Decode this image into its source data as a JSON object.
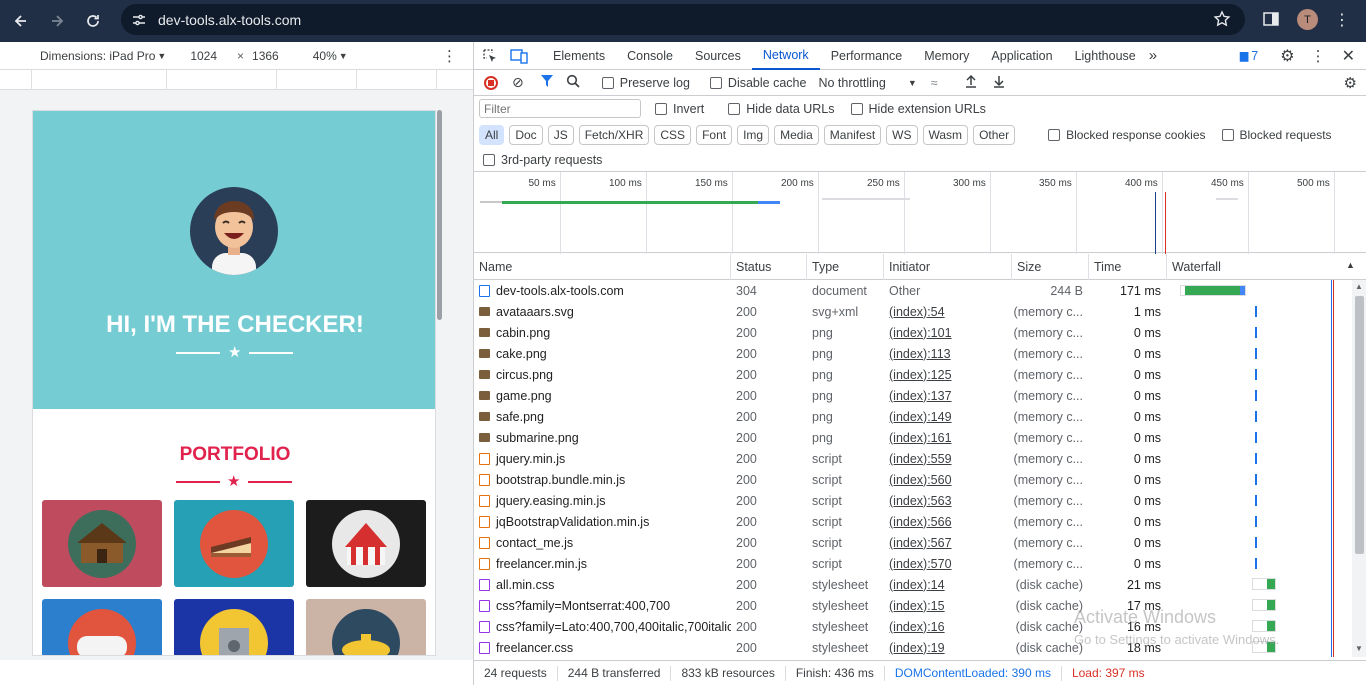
{
  "browser": {
    "url": "dev-tools.alx-tools.com",
    "profile_initial": "T"
  },
  "emulation": {
    "device": "Dimensions: iPad Pro",
    "width": "1024",
    "times": "×",
    "height": "1366",
    "zoom": "40%"
  },
  "page": {
    "hero_title": "HI, I'M THE CHECKER!",
    "portfolio_title": "PORTFOLIO",
    "tiles": [
      {
        "name": "cabin",
        "bg": "#be4b5e"
      },
      {
        "name": "cake",
        "bg": "#25a0b4"
      },
      {
        "name": "circus",
        "bg": "#1c1c1c"
      },
      {
        "name": "game",
        "bg": "#2b7fcc"
      },
      {
        "name": "safe",
        "bg": "#1b35a6"
      },
      {
        "name": "submarine",
        "bg": "#cbb3a6"
      }
    ]
  },
  "devtools": {
    "tabs": [
      "Elements",
      "Console",
      "Sources",
      "Network",
      "Performance",
      "Memory",
      "Application",
      "Lighthouse"
    ],
    "active_tab": "Network",
    "messages_count": "7",
    "toolbar": {
      "preserve_log": "Preserve log",
      "disable_cache": "Disable cache",
      "throttling": "No throttling"
    },
    "filter": {
      "placeholder": "Filter",
      "invert": "Invert",
      "hide_data_urls": "Hide data URLs",
      "hide_extension_urls": "Hide extension URLs"
    },
    "types": [
      "All",
      "Doc",
      "JS",
      "Fetch/XHR",
      "CSS",
      "Font",
      "Img",
      "Media",
      "Manifest",
      "WS",
      "Wasm",
      "Other"
    ],
    "blocked_response_cookies": "Blocked response cookies",
    "blocked_requests": "Blocked requests",
    "third_party": "3rd-party requests",
    "overview_ticks": [
      "50 ms",
      "100 ms",
      "150 ms",
      "200 ms",
      "250 ms",
      "300 ms",
      "350 ms",
      "400 ms",
      "450 ms",
      "500 ms"
    ],
    "columns": {
      "name": "Name",
      "status": "Status",
      "type": "Type",
      "initiator": "Initiator",
      "size": "Size",
      "time": "Time",
      "waterfall": "Waterfall"
    },
    "rows": [
      {
        "name": "dev-tools.alx-tools.com",
        "status": "304",
        "type": "document",
        "initiator": "Other",
        "size": "244 B",
        "time": "171 ms",
        "kind": "doc"
      },
      {
        "name": "avataaars.svg",
        "status": "200",
        "type": "svg+xml",
        "initiator": "(index):54",
        "size": "(memory c...",
        "time": "1 ms",
        "kind": "img"
      },
      {
        "name": "cabin.png",
        "status": "200",
        "type": "png",
        "initiator": "(index):101",
        "size": "(memory c...",
        "time": "0 ms",
        "kind": "img"
      },
      {
        "name": "cake.png",
        "status": "200",
        "type": "png",
        "initiator": "(index):113",
        "size": "(memory c...",
        "time": "0 ms",
        "kind": "img"
      },
      {
        "name": "circus.png",
        "status": "200",
        "type": "png",
        "initiator": "(index):125",
        "size": "(memory c...",
        "time": "0 ms",
        "kind": "img"
      },
      {
        "name": "game.png",
        "status": "200",
        "type": "png",
        "initiator": "(index):137",
        "size": "(memory c...",
        "time": "0 ms",
        "kind": "img"
      },
      {
        "name": "safe.png",
        "status": "200",
        "type": "png",
        "initiator": "(index):149",
        "size": "(memory c...",
        "time": "0 ms",
        "kind": "img"
      },
      {
        "name": "submarine.png",
        "status": "200",
        "type": "png",
        "initiator": "(index):161",
        "size": "(memory c...",
        "time": "0 ms",
        "kind": "img"
      },
      {
        "name": "jquery.min.js",
        "status": "200",
        "type": "script",
        "initiator": "(index):559",
        "size": "(memory c...",
        "time": "0 ms",
        "kind": "js"
      },
      {
        "name": "bootstrap.bundle.min.js",
        "status": "200",
        "type": "script",
        "initiator": "(index):560",
        "size": "(memory c...",
        "time": "0 ms",
        "kind": "js"
      },
      {
        "name": "jquery.easing.min.js",
        "status": "200",
        "type": "script",
        "initiator": "(index):563",
        "size": "(memory c...",
        "time": "0 ms",
        "kind": "js"
      },
      {
        "name": "jqBootstrapValidation.min.js",
        "status": "200",
        "type": "script",
        "initiator": "(index):566",
        "size": "(memory c...",
        "time": "0 ms",
        "kind": "js"
      },
      {
        "name": "contact_me.js",
        "status": "200",
        "type": "script",
        "initiator": "(index):567",
        "size": "(memory c...",
        "time": "0 ms",
        "kind": "js"
      },
      {
        "name": "freelancer.min.js",
        "status": "200",
        "type": "script",
        "initiator": "(index):570",
        "size": "(memory c...",
        "time": "0 ms",
        "kind": "js"
      },
      {
        "name": "all.min.css",
        "status": "200",
        "type": "stylesheet",
        "initiator": "(index):14",
        "size": "(disk cache)",
        "time": "21 ms",
        "kind": "css"
      },
      {
        "name": "css?family=Montserrat:400,700",
        "status": "200",
        "type": "stylesheet",
        "initiator": "(index):15",
        "size": "(disk cache)",
        "time": "17 ms",
        "kind": "css"
      },
      {
        "name": "css?family=Lato:400,700,400italic,700italic",
        "status": "200",
        "type": "stylesheet",
        "initiator": "(index):16",
        "size": "(disk cache)",
        "time": "16 ms",
        "kind": "css"
      },
      {
        "name": "freelancer.css",
        "status": "200",
        "type": "stylesheet",
        "initiator": "(index):19",
        "size": "(disk cache)",
        "time": "18 ms",
        "kind": "css"
      }
    ],
    "status_bar": {
      "requests": "24 requests",
      "transferred": "244 B transferred",
      "resources": "833 kB resources",
      "finish": "Finish: 436 ms",
      "dcl": "DOMContentLoaded: 390 ms",
      "load": "Load: 397 ms"
    },
    "watermark": {
      "title": "Activate Windows",
      "subtitle": "Go to Settings to activate Windows."
    }
  },
  "colors": {
    "accent": "#0b57d0",
    "dcl": "#1a73e8",
    "load": "#d93025",
    "hero": "#75cdd3",
    "portfolio": "#e0224c"
  }
}
